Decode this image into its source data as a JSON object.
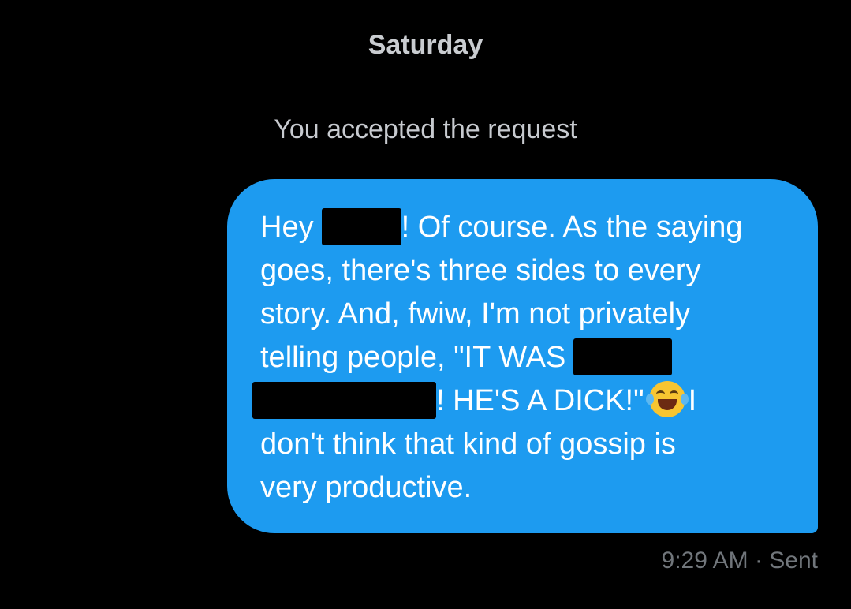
{
  "conversation": {
    "day_label": "Saturday",
    "system_note": "You accepted the request"
  },
  "message": {
    "lines": [
      {
        "before": "Hey",
        "after": "! Of course. As the saying"
      },
      "goes, there's three sides to every",
      "story. And, fwiw, I'm not privately",
      {
        "before": "telling people, \"IT WAS"
      },
      {
        "after": "! HE'S A DICK!\"",
        "after_emoji": "I"
      },
      "don't think that kind of gossip is",
      "very productive."
    ],
    "emoji": "face-with-tears-of-joy",
    "time": "9:29 AM",
    "separator": "·",
    "status": "Sent"
  }
}
